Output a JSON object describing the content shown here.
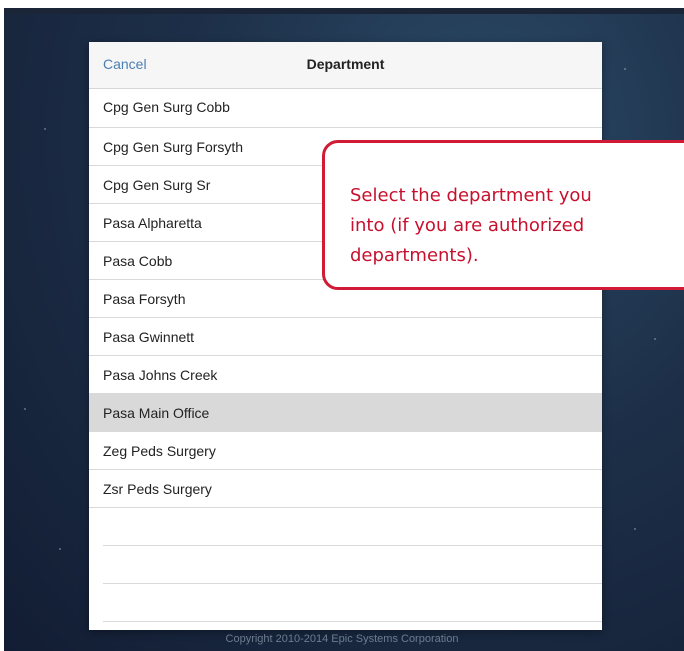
{
  "modal": {
    "cancel_label": "Cancel",
    "title": "Department",
    "departments": [
      {
        "label": "Cpg Gen Surg Cobb",
        "selected": false
      },
      {
        "label": "Cpg Gen Surg Forsyth",
        "selected": false
      },
      {
        "label": "Cpg Gen Surg Sr",
        "selected": false
      },
      {
        "label": "Pasa Alpharetta",
        "selected": false
      },
      {
        "label": "Pasa Cobb",
        "selected": false
      },
      {
        "label": "Pasa Forsyth",
        "selected": false
      },
      {
        "label": "Pasa Gwinnett",
        "selected": false
      },
      {
        "label": "Pasa Johns Creek",
        "selected": false
      },
      {
        "label": "Pasa Main Office",
        "selected": true
      },
      {
        "label": "Zeg Peds Surgery",
        "selected": false
      },
      {
        "label": "Zsr Peds Surgery",
        "selected": false
      }
    ]
  },
  "callout": {
    "line1": "Select the department you",
    "line2": "into (if you are authorized",
    "line3": "departments)."
  },
  "footer": {
    "copyright": "Copyright 2010-2014 Epic Systems Corporation"
  },
  "colors": {
    "accent": "#4a7fb3",
    "callout_border": "#d11a36",
    "selected_row": "#d9d9d9"
  }
}
